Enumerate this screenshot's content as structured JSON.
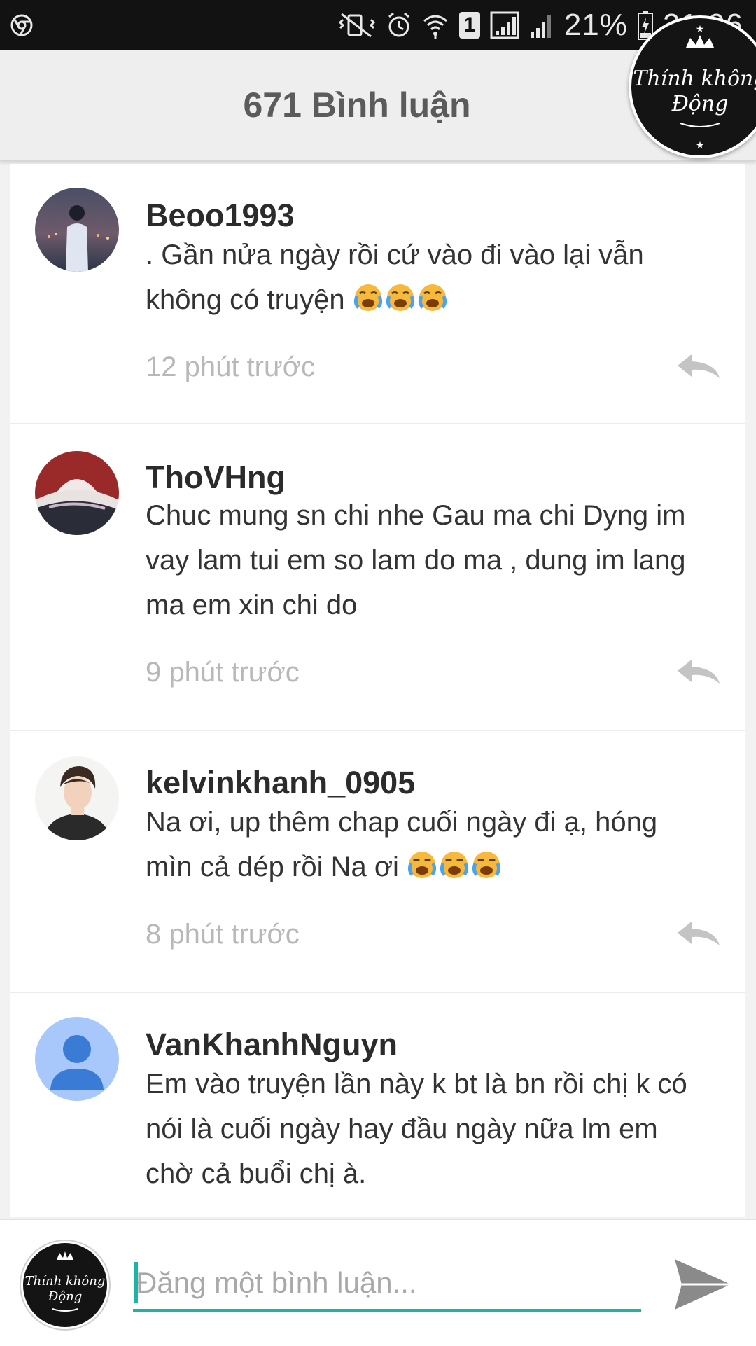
{
  "status_bar": {
    "battery": "21%",
    "sim_number": "1",
    "time": "21:06",
    "icons": [
      "chrome-icon",
      "mute-vibrate-icon",
      "alarm-icon",
      "wifi-icon",
      "sim-icon",
      "signal-icon",
      "signal-icon",
      "battery-charging-icon"
    ]
  },
  "header": {
    "title": "671 Bình luận",
    "logo_text_line1": "Thính không",
    "logo_text_line2": "Động"
  },
  "comments": [
    {
      "username": "Beoo1993",
      "text_lines": [
        ". Gần nửa ngày rồi cứ vào đi vào lại vẫn",
        "không có truyện"
      ],
      "emoji_count": 3,
      "time": "12 phút trước"
    },
    {
      "username": "ThoVHng",
      "text_lines": [
        "Chuc mung sn chi nhe Gau ma chi Dyng im",
        "vay lam tui em so lam do ma , dung im lang",
        "ma em xin chi do"
      ],
      "emoji_count": 0,
      "time": "9 phút trước"
    },
    {
      "username": "kelvinkhanh_0905",
      "text_lines": [
        "Na ơi, up thêm chap cuối ngày đi ạ, hóng",
        "mìn cả dép rồi Na ơi"
      ],
      "emoji_count": 3,
      "time": "8 phút trước"
    },
    {
      "username": "VanKhanhNguyn",
      "text_lines": [
        "Em vào truyện lần này  k bt là bn rồi chị k có",
        "nói là cuối ngày hay đầu ngày nữa lm em",
        "chờ cả buổi chị à."
      ],
      "emoji_count": 0,
      "time": ""
    }
  ],
  "composer": {
    "placeholder": "Đăng một bình luận...",
    "value": ""
  },
  "colors": {
    "accent": "#1fb2a6",
    "header_bg": "#eeeeee",
    "status_bar_bg": "#121212",
    "time_text": "#b8b8b8"
  }
}
